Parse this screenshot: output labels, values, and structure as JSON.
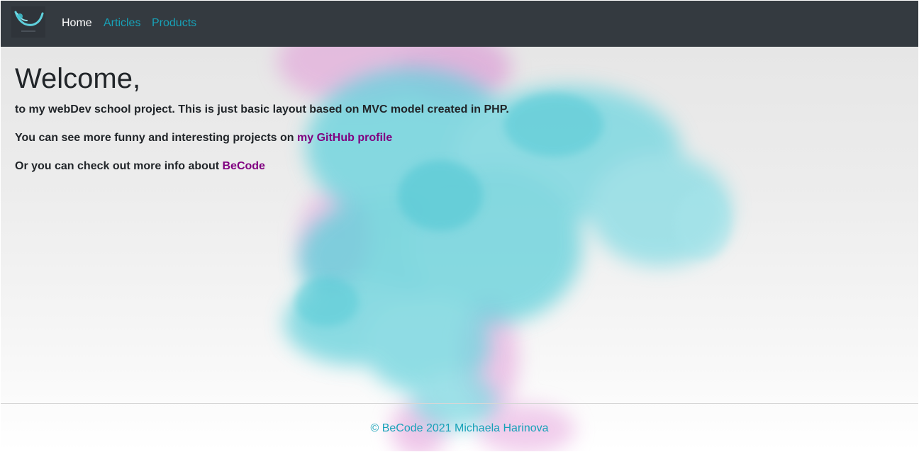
{
  "navbar": {
    "logo_icon": "becode-logo-icon",
    "links": [
      {
        "label": "Home",
        "active": true
      },
      {
        "label": "Articles",
        "active": false
      },
      {
        "label": "Products",
        "active": false
      }
    ]
  },
  "main": {
    "title": "Welcome,",
    "intro": "to my webDev school project. This is just basic layout based on MVC model created in PHP.",
    "github_text": "You can see more funny and interesting projects on ",
    "github_link": "my GitHub profile",
    "becode_text": "Or you can check out more info about ",
    "becode_link": "BeCode"
  },
  "footer": {
    "text": "© BeCode 2021 Michaela Harinova"
  },
  "colors": {
    "navbar_bg": "#343a40",
    "nav_link": "#17a2b8",
    "nav_active": "#ffffff",
    "visited_link": "#800080",
    "smoke_cyan": "#5fd0dc",
    "smoke_pink": "#e29ad8"
  }
}
